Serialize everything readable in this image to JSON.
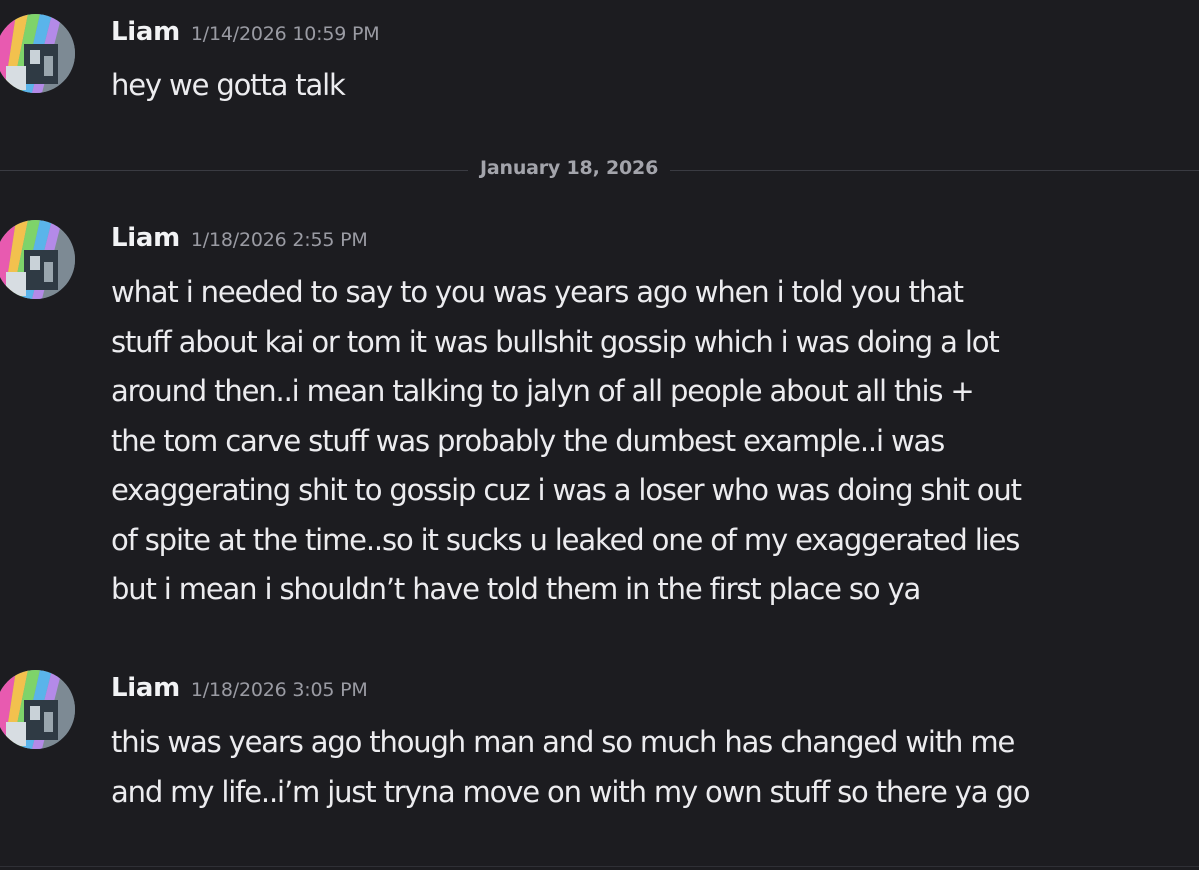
{
  "messages": [
    {
      "author": "Liam",
      "timestamp": "1/14/2026 10:59 PM",
      "text": "hey we gotta talk"
    },
    {
      "author": "Liam",
      "timestamp": "1/18/2026 2:55 PM",
      "text": "what i needed to say to you was years ago when i told you that\nstuff about kai or tom it was bullshit gossip which i was doing a lot\naround then..i mean talking to jalyn of all people about all this +\nthe tom carve stuff was probably the dumbest example..i was\nexaggerating shit to gossip cuz i was a loser who was doing shit out\nof spite at the time..so it sucks u leaked one of my exaggerated lies\nbut i mean i shouldn’t have told them in the first place so ya"
    },
    {
      "author": "Liam",
      "timestamp": "1/18/2026 3:05 PM",
      "text": "this was years ago though man and so much has changed with me\nand my life..i’m just tryna move on with my own stuff so there ya go"
    }
  ],
  "date_divider": "January 18, 2026",
  "avatar_icon": "rainbow-photo-avatar-icon",
  "colors": {
    "background": "#1c1c20",
    "author": "#f2f3f5",
    "timestamp": "#9a9ba3",
    "message_text": "#ececef",
    "divider": "#3a3b42"
  }
}
